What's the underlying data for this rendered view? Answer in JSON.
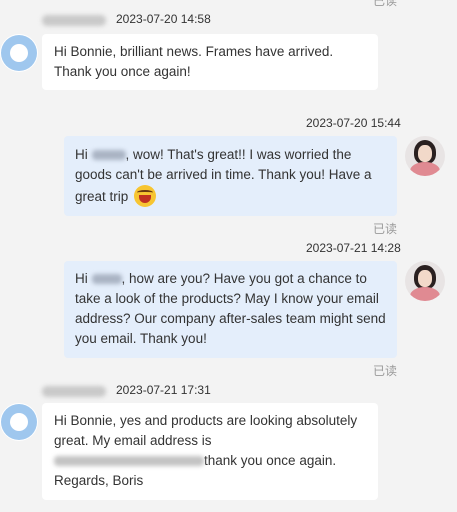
{
  "messages": [
    {
      "time": "2023-07-20 14:58",
      "text": "Hi Bonnie, brilliant news. Frames have arrived. Thank you once again!"
    },
    {
      "time": "2023-07-20 15:44",
      "text_a": "Hi ",
      "text_b": ", wow! That's great!! I was worried the goods can't be arrived in time. Thank you! Have a great trip",
      "read": "已读"
    },
    {
      "time": "2023-07-21 14:28",
      "text_a": "Hi ",
      "text_b": ", how are you? Have you got a chance to take a look of the products? May I know your email address? Our company after-sales team might send you email. Thank you!",
      "read": "已读"
    },
    {
      "time": "2023-07-21 17:31",
      "line1": "Hi Bonnie, yes and products are looking absolutely great. My email address is",
      "line2": "thank you once again.",
      "line3": "Regards, Boris"
    }
  ],
  "top_read": "已读"
}
